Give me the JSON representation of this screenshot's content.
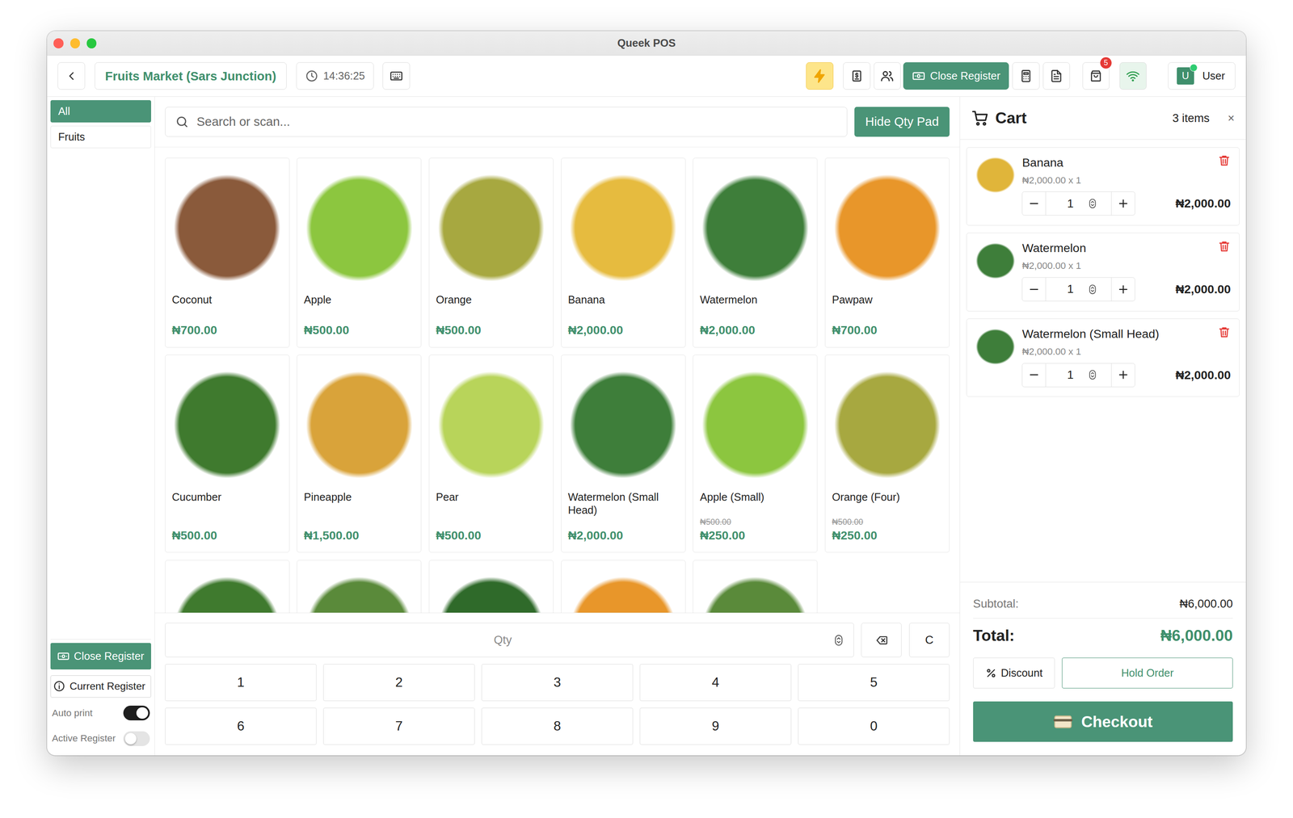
{
  "window": {
    "title": "Queek POS"
  },
  "toolbar": {
    "store": "Fruits Market (Sars Junction)",
    "time": "14:36:25",
    "close_register": "Close Register",
    "orders_badge": "5",
    "user_initial": "U",
    "user": "User",
    "online": true
  },
  "categories": [
    {
      "label": "All",
      "selected": true
    },
    {
      "label": "Fruits",
      "selected": false
    }
  ],
  "sidebar": {
    "close_register": "Close Register",
    "current_register": "Current Register",
    "toggles": [
      {
        "label": "Auto print",
        "on": true
      },
      {
        "label": "Active Register",
        "on": false
      }
    ]
  },
  "search": {
    "placeholder": "Search or scan...",
    "hide_qty_pad": "Hide Qty Pad"
  },
  "products": [
    {
      "name": "Coconut",
      "price": "₦700.00",
      "color": "#8a5a3b"
    },
    {
      "name": "Apple",
      "price": "₦500.00",
      "color": "#8cc63f"
    },
    {
      "name": "Orange",
      "price": "₦500.00",
      "color": "#a7a840"
    },
    {
      "name": "Banana",
      "price": "₦2,000.00",
      "color": "#e6bb3f"
    },
    {
      "name": "Watermelon",
      "price": "₦2,000.00",
      "color": "#3e7e3a"
    },
    {
      "name": "Pawpaw",
      "price": "₦700.00",
      "color": "#e8962a"
    },
    {
      "name": "Cucumber",
      "price": "₦500.00",
      "color": "#3f7a2e"
    },
    {
      "name": "Pineapple",
      "price": "₦1,500.00",
      "color": "#d9a33a"
    },
    {
      "name": "Pear",
      "price": "₦500.00",
      "color": "#b8d45a"
    },
    {
      "name": "Watermelon (Small Head)",
      "price": "₦2,000.00",
      "color": "#3e7e3a"
    },
    {
      "name": "Apple (Small)",
      "old_price": "₦500.00",
      "price": "₦250.00",
      "color": "#8cc63f"
    },
    {
      "name": "Orange (Four)",
      "old_price": "₦500.00",
      "price": "₦250.00",
      "color": "#a7a840"
    }
  ],
  "products_cut_off": [
    {
      "color": "#3f7a2e"
    },
    {
      "color": "#5a8a3a"
    },
    {
      "color": "#2f6a2a"
    },
    {
      "color": "#e8962a"
    },
    {
      "color": "#5a8a3a"
    }
  ],
  "qty_pad": {
    "placeholder": "Qty",
    "clear": "C",
    "keys": [
      "1",
      "2",
      "3",
      "4",
      "5",
      "6",
      "7",
      "8",
      "9",
      "0"
    ]
  },
  "cart": {
    "title": "Cart",
    "count": "3 items",
    "close": "×",
    "items": [
      {
        "name": "Banana",
        "unit": "₦2,000.00 x 1",
        "qty": "1",
        "total": "₦2,000.00",
        "color": "#e0b53a"
      },
      {
        "name": "Watermelon",
        "unit": "₦2,000.00 x 1",
        "qty": "1",
        "total": "₦2,000.00",
        "color": "#3e7e3a"
      },
      {
        "name": "Watermelon (Small Head)",
        "unit": "₦2,000.00 x 1",
        "qty": "1",
        "total": "₦2,000.00",
        "color": "#3e7e3a"
      }
    ],
    "subtotal_label": "Subtotal:",
    "subtotal": "₦6,000.00",
    "total_label": "Total:",
    "total": "₦6,000.00",
    "discount": "Discount",
    "hold": "Hold Order",
    "checkout": "Checkout"
  }
}
